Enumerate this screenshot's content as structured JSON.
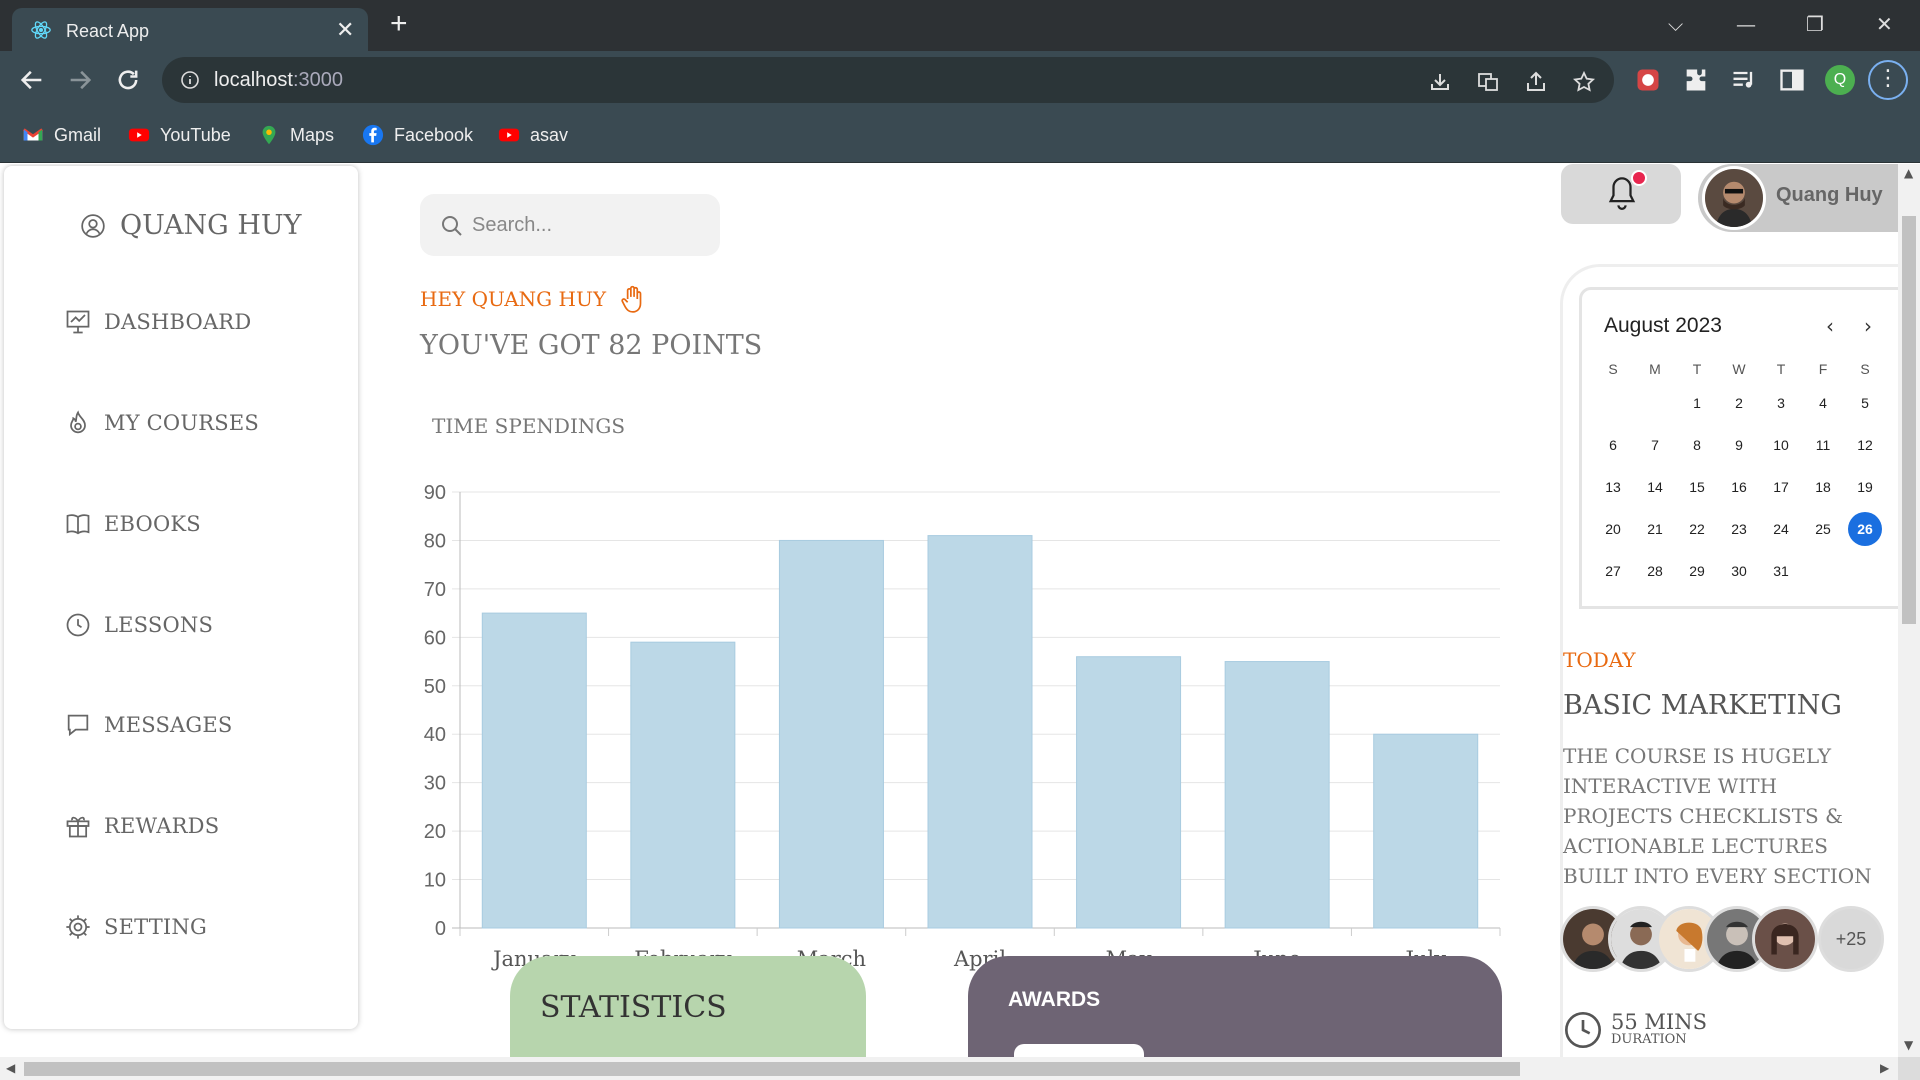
{
  "browser": {
    "tab_title": "React App",
    "url_host": "localhost",
    "url_port": ":3000",
    "bookmarks": [
      {
        "label": "Gmail",
        "icon": "gmail-icon"
      },
      {
        "label": "YouTube",
        "icon": "youtube-icon"
      },
      {
        "label": "Maps",
        "icon": "maps-icon"
      },
      {
        "label": "Facebook",
        "icon": "facebook-icon"
      },
      {
        "label": "asav",
        "icon": "youtube-icon"
      }
    ],
    "profile_initial": "Q"
  },
  "sidebar": {
    "brand": "QUANG HUY",
    "items": [
      {
        "label": "DASHBOARD",
        "icon": "presentation-chart-icon"
      },
      {
        "label": "MY COURSES",
        "icon": "flame-icon"
      },
      {
        "label": "EBOOKS",
        "icon": "book-icon"
      },
      {
        "label": "LESSONS",
        "icon": "clock-icon"
      },
      {
        "label": "MESSAGES",
        "icon": "chat-bubble-icon"
      },
      {
        "label": "REWARDS",
        "icon": "gift-icon"
      },
      {
        "label": "SETTING",
        "icon": "gear-icon"
      }
    ]
  },
  "main": {
    "search_placeholder": "Search...",
    "greeting": "HEY QUANG HUY",
    "points_text": "YOU'VE GOT 82 POINTS",
    "chart_title": "TIME SPENDINGS",
    "statistics_label": "STATISTICS",
    "awards_label": "AWARDS"
  },
  "header": {
    "user_name": "Quang Huy",
    "has_notification": true
  },
  "calendar": {
    "month_label": "August 2023",
    "weekdays": [
      "S",
      "M",
      "T",
      "W",
      "T",
      "F",
      "S"
    ],
    "weeks": [
      [
        "",
        "",
        "1",
        "2",
        "3",
        "4",
        "5"
      ],
      [
        "6",
        "7",
        "8",
        "9",
        "10",
        "11",
        "12"
      ],
      [
        "13",
        "14",
        "15",
        "16",
        "17",
        "18",
        "19"
      ],
      [
        "20",
        "21",
        "22",
        "23",
        "24",
        "25",
        "26"
      ],
      [
        "27",
        "28",
        "29",
        "30",
        "31",
        "",
        ""
      ]
    ],
    "selected_day": "26",
    "selected_color": "#1a6fe0"
  },
  "today": {
    "label": "TODAY",
    "course_name": "BASIC MARKETING",
    "course_description": "THE COURSE IS HUGELY INTERACTIVE WITH PROJECTS CHECKLISTS & ACTIONABLE LECTURES BUILT INTO EVERY SECTION",
    "participants_more": "+25",
    "duration_value": "55 MINS",
    "duration_label": "DURATION"
  },
  "colors": {
    "accent": "#e86a12",
    "bar": "#bcd8e7",
    "statistics_card": "#b7d5ad",
    "awards_card": "#6e6474",
    "notification_dot": "#e8264f"
  },
  "chart_data": {
    "type": "bar",
    "categories": [
      "January",
      "February",
      "March",
      "April",
      "May",
      "June",
      "July"
    ],
    "values": [
      65,
      59,
      80,
      81,
      56,
      55,
      40
    ],
    "ylim": [
      0,
      90
    ],
    "yticks": [
      "0",
      "10",
      "20",
      "30",
      "40",
      "50",
      "60",
      "70",
      "80",
      "90"
    ],
    "grid": true,
    "legend": "none"
  }
}
